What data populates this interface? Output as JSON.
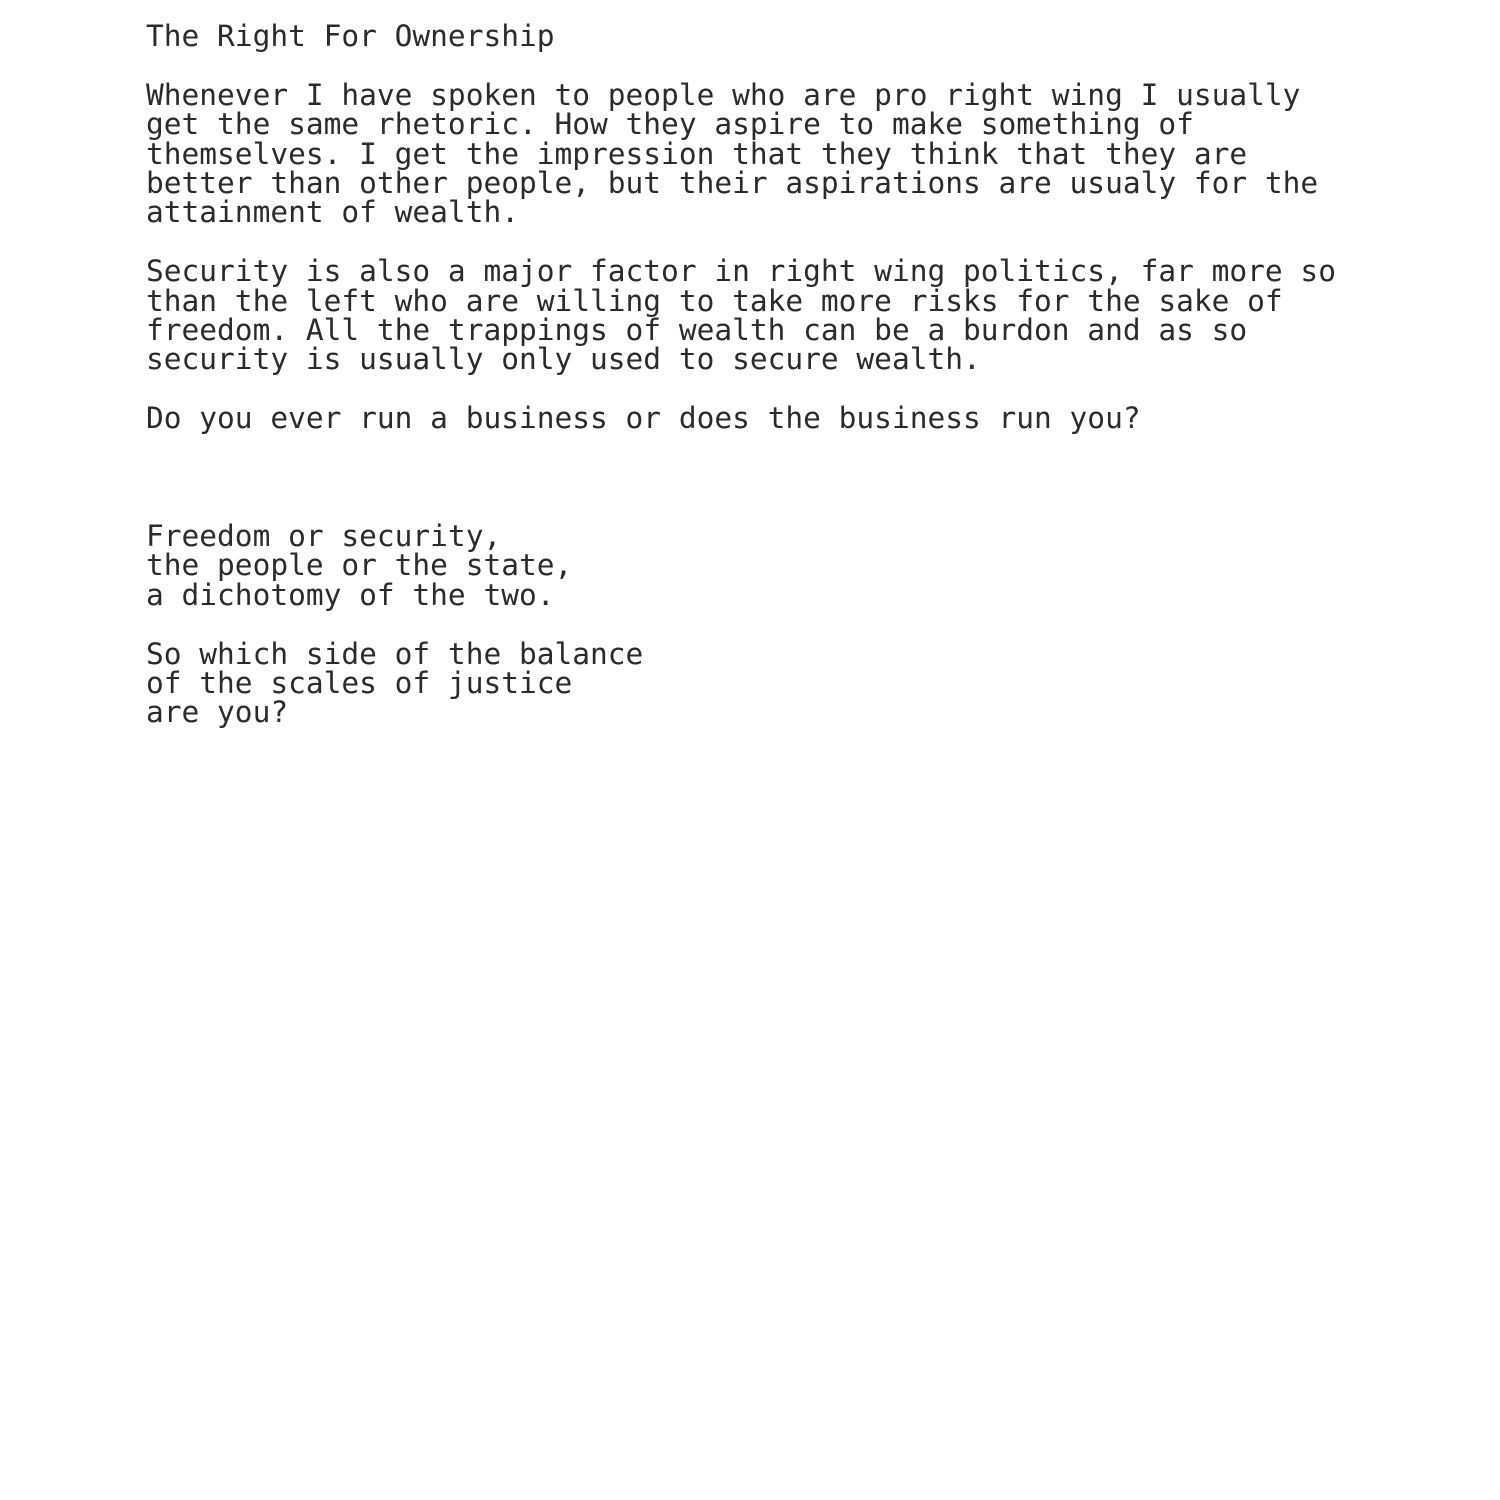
{
  "document": {
    "title": "The Right For Ownership",
    "text_color": "#2b2b2b",
    "background_color": "#ffffff",
    "blocks": [
      {
        "name": "title",
        "lines": [
          "The Right For Ownership"
        ]
      },
      {
        "name": "spacer-1",
        "lines": [
          " "
        ]
      },
      {
        "name": "paragraph-1",
        "lines": [
          "Whenever I have spoken to people who are pro right wing I usually",
          "get the same rhetoric. How they aspire to make something of",
          "themselves. I get the impression that they think that they are",
          "better than other people, but their aspirations are usualy for the",
          "attainment of wealth."
        ]
      },
      {
        "name": "spacer-2",
        "lines": [
          " "
        ]
      },
      {
        "name": "paragraph-2",
        "lines": [
          "Security is also a major factor in right wing politics, far more so",
          "than the left who are willing to take more risks for the sake of",
          "freedom. All the trappings of wealth can be a burdon and as so",
          "security is usually only used to secure wealth."
        ]
      },
      {
        "name": "spacer-3",
        "lines": [
          " "
        ]
      },
      {
        "name": "paragraph-3",
        "lines": [
          "Do you ever run a business or does the business run you?"
        ]
      },
      {
        "name": "spacer-4",
        "lines": [
          " ",
          " ",
          " "
        ]
      },
      {
        "name": "verse-1",
        "lines": [
          "Freedom or security,",
          "the people or the state,",
          "a dichotomy of the two."
        ]
      },
      {
        "name": "spacer-5",
        "lines": [
          " "
        ]
      },
      {
        "name": "verse-2",
        "lines": [
          "So which side of the balance",
          "of the scales of justice",
          "are you?"
        ]
      }
    ]
  }
}
